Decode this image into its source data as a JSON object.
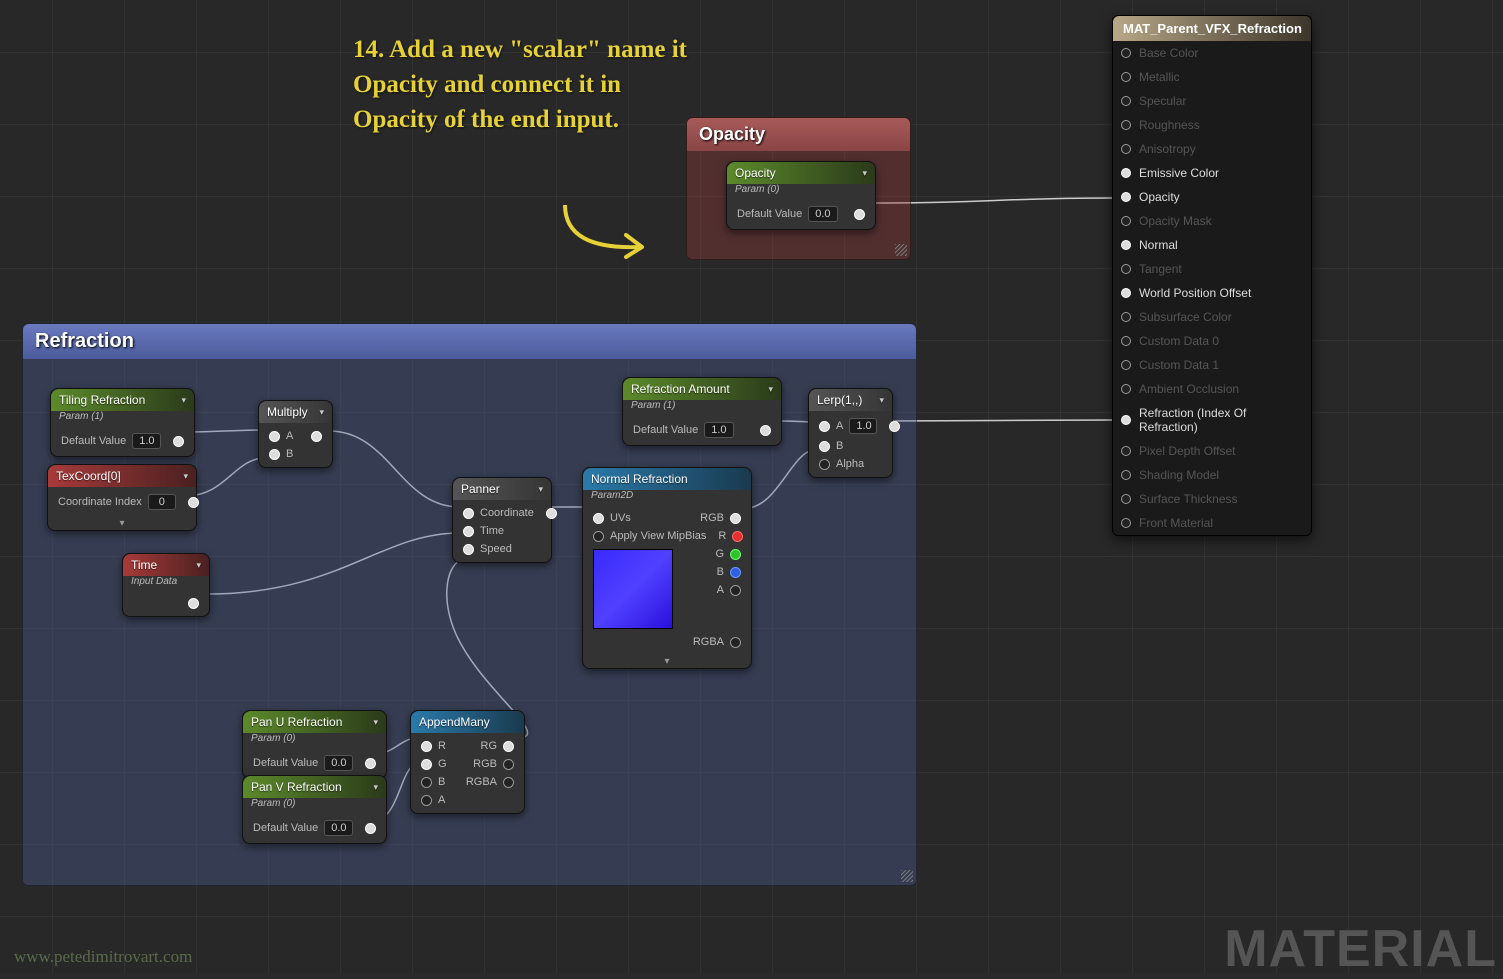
{
  "annotation": "14. Add a new \"scalar\" name it Opacity and connect it in Opacity of the end input.",
  "comments": {
    "opacity": "Opacity",
    "refraction": "Refraction"
  },
  "nodes": {
    "opacity_param": {
      "title": "Opacity",
      "sub": "Param (0)",
      "default_label": "Default Value",
      "default_value": "0.0"
    },
    "tiling": {
      "title": "Tiling Refraction",
      "sub": "Param (1)",
      "default_label": "Default Value",
      "default_value": "1.0"
    },
    "texcoord": {
      "title": "TexCoord[0]",
      "label": "Coordinate Index",
      "value": "0"
    },
    "time": {
      "title": "Time",
      "sub": "Input Data"
    },
    "multiply": {
      "title": "Multiply",
      "pins": [
        "A",
        "B"
      ]
    },
    "panner": {
      "title": "Panner",
      "pins": [
        "Coordinate",
        "Time",
        "Speed"
      ]
    },
    "refr_amt": {
      "title": "Refraction Amount",
      "sub": "Param (1)",
      "default_label": "Default Value",
      "default_value": "1.0"
    },
    "lerp": {
      "title": "Lerp(1,,)",
      "a": "A",
      "aval": "1.0",
      "b": "B",
      "alpha": "Alpha"
    },
    "normal": {
      "title": "Normal Refraction",
      "sub": "Param2D",
      "uvs": "UVs",
      "mip": "Apply View MipBias",
      "rgb": "RGB",
      "r": "R",
      "g": "G",
      "b": "B",
      "a": "A",
      "rgba": "RGBA"
    },
    "panu": {
      "title": "Pan U Refraction",
      "sub": "Param (0)",
      "default_label": "Default Value",
      "default_value": "0.0"
    },
    "panv": {
      "title": "Pan V Refraction",
      "sub": "Param (0)",
      "default_label": "Default Value",
      "default_value": "0.0"
    },
    "append": {
      "title": "AppendMany",
      "r": "R",
      "g": "G",
      "b": "B",
      "a": "A",
      "rg": "RG",
      "rgb": "RGB",
      "rgba": "RGBA"
    }
  },
  "material": {
    "title": "MAT_Parent_VFX_Refraction",
    "pins": [
      {
        "label": "Base Color",
        "on": false
      },
      {
        "label": "Metallic",
        "on": false
      },
      {
        "label": "Specular",
        "on": false
      },
      {
        "label": "Roughness",
        "on": false
      },
      {
        "label": "Anisotropy",
        "on": false
      },
      {
        "label": "Emissive Color",
        "on": true
      },
      {
        "label": "Opacity",
        "on": true
      },
      {
        "label": "Opacity Mask",
        "on": false
      },
      {
        "label": "Normal",
        "on": true
      },
      {
        "label": "Tangent",
        "on": false
      },
      {
        "label": "World Position Offset",
        "on": true
      },
      {
        "label": "Subsurface Color",
        "on": false
      },
      {
        "label": "Custom Data 0",
        "on": false
      },
      {
        "label": "Custom Data 1",
        "on": false
      },
      {
        "label": "Ambient Occlusion",
        "on": false
      },
      {
        "label": "Refraction (Index Of Refraction)",
        "on": true
      },
      {
        "label": "Pixel Depth Offset",
        "on": false
      },
      {
        "label": "Shading Model",
        "on": false
      },
      {
        "label": "Surface Thickness",
        "on": false
      },
      {
        "label": "Front Material",
        "on": false
      }
    ]
  },
  "watermark": {
    "url": "www.petedimitrovart.com",
    "mat": "MATERIAL"
  }
}
